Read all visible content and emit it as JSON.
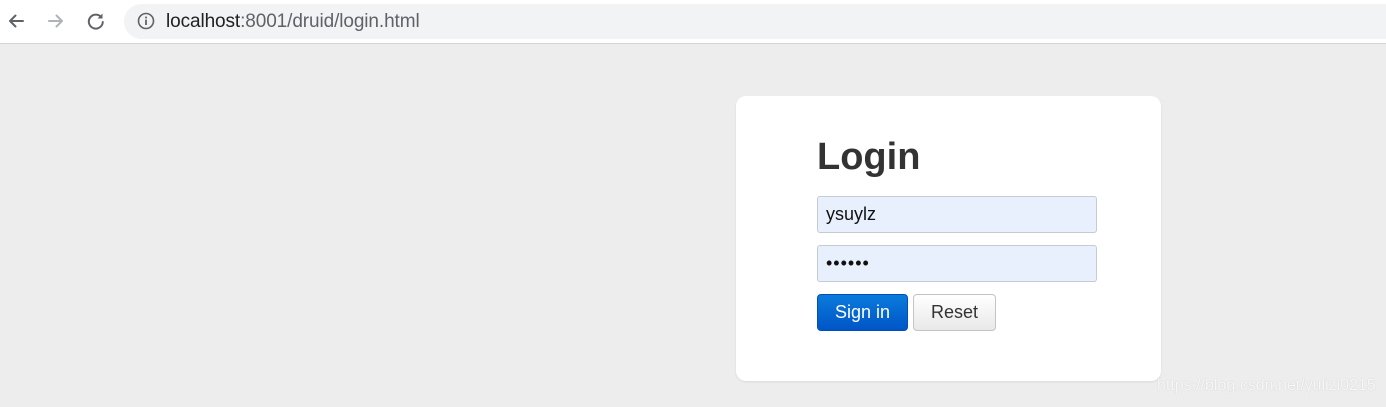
{
  "browser": {
    "back_icon": "arrow-left-icon",
    "forward_icon": "arrow-right-icon",
    "reload_icon": "reload-icon",
    "site_info_icon": "info-circle-icon",
    "url_host": "localhost",
    "url_rest": ":8001/druid/login.html"
  },
  "login": {
    "title": "Login",
    "username_value": "ysuylz",
    "password_value": "••••••",
    "signin_label": "Sign in",
    "reset_label": "Reset"
  },
  "watermark": "https://blog.csdn.net/yulizi0215",
  "colors": {
    "page_background": "#ededed",
    "card_background": "#ffffff",
    "input_autofill": "#e8f0fe",
    "primary_button": "#0060cc"
  }
}
